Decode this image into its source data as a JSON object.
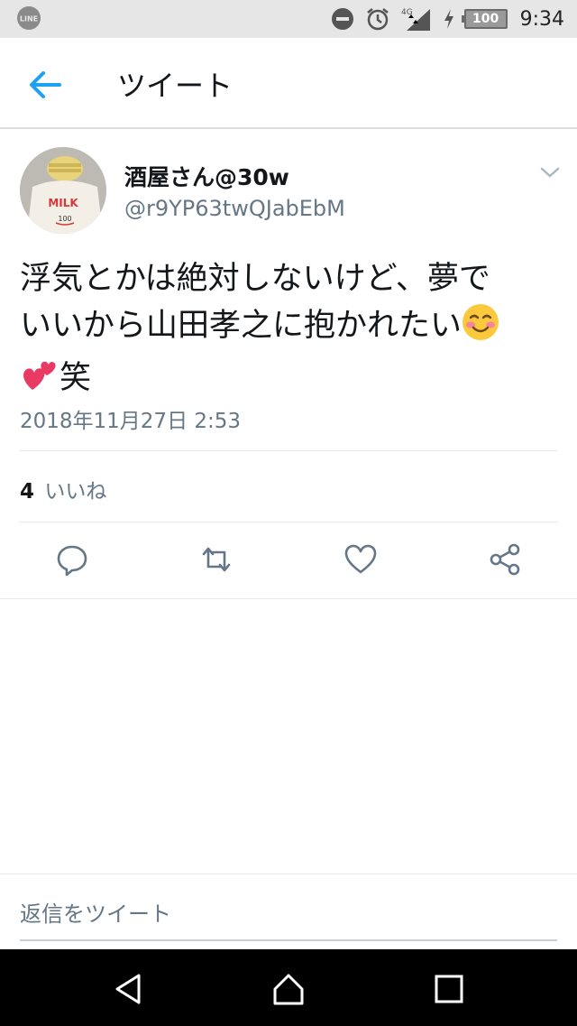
{
  "status_bar": {
    "app_icon": "line-icon",
    "network_label": "4G",
    "battery_level": "100",
    "time": "9:34"
  },
  "app_bar": {
    "title": "ツイート",
    "back_icon": "arrow-left-icon"
  },
  "tweet": {
    "display_name": "酒屋さん@30w",
    "handle": "@r9YP63twQJabEbM",
    "text_line1": "浮気とかは絶対しないけど、夢で",
    "text_line2": "いいから山田孝之に抱かれたい",
    "text_line3": "笑",
    "timestamp": "2018年11月27日 2:53",
    "likes_count": "4",
    "likes_label": "いいね",
    "avatar_text": "MILK",
    "avatar_number": "100"
  },
  "reply": {
    "placeholder": "返信をツイート"
  },
  "colors": {
    "accent": "#1da1f2",
    "secondary_text": "#657786",
    "icon_gray": "#657786"
  }
}
